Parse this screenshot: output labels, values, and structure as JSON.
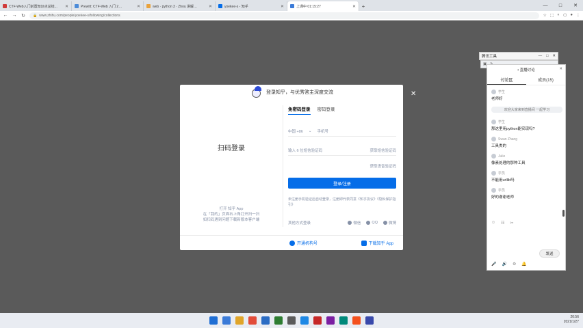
{
  "browser": {
    "tabs": [
      {
        "title": "CTF-Web入门前置知识点总结...",
        "color": "#d03b3b",
        "active": false
      },
      {
        "title": "Prewitt: CTF-Web 入门 2…",
        "color": "#4b8bd8",
        "active": false
      },
      {
        "title": "web · python 3 · Zhou 讲解…",
        "color": "#e9a23b",
        "active": false
      },
      {
        "title": "yoekee-s - 知乎",
        "color": "#056de8",
        "active": false
      },
      {
        "title": "上课中 01:15:27",
        "color": "#3b7bd8",
        "active": true
      }
    ],
    "address": "www.zhihu.com/people/yoekee-s/following/collections",
    "window_controls": [
      "—",
      "□",
      "✕"
    ]
  },
  "modal": {
    "header_text": "登录知乎，与优秀答主深度交流",
    "qr_title": "扫码登录",
    "qr_hint_line1": "打开 知乎 App",
    "qr_hint_line2": "在「我的」页面右上角打开扫一扫",
    "qr_hint_line3": "如扫码遇到问题下载新版本客户端",
    "tab_sms": "免密码登录",
    "tab_password": "密码登录",
    "phone_region": "中国 +86",
    "phone_placeholder": "手机号",
    "code_placeholder": "输入 6 位短信验证码",
    "get_code": "获取短信验证码",
    "voice_code": "获取语音验证码",
    "login_button": "登录/注册",
    "agreement": "未注册手机验证后自动登录，注册即代表同意《知乎协议》《隐私保护指引》",
    "social_label": "其他方式登录",
    "social_items": [
      "微信",
      "QQ",
      "微博"
    ],
    "footer_left": "开通机构号",
    "footer_right": "下载知乎 App",
    "close": "✕"
  },
  "tool": {
    "title": "腾讯工具",
    "controls": [
      "—",
      "□",
      "✕"
    ]
  },
  "chat": {
    "header": "• 直播讨论",
    "close": "✕",
    "tab_discuss": "讨论区",
    "tab_members": "成员(15)",
    "system_note": "欢迎大家来到直播间 一起学习",
    "messages": [
      {
        "user": "学生",
        "text": "老师好"
      },
      {
        "user": "学生",
        "text": "那这里用python能实现吗?"
      },
      {
        "user": "Swan Zhang",
        "text": "工具类的"
      },
      {
        "user": "Julie",
        "text": "像素处理的那种工具"
      },
      {
        "user": "学员",
        "text": "不能用urllib吗"
      },
      {
        "user": "学员",
        "text": "好的谢谢老师"
      }
    ],
    "send": "发送",
    "bottom_icons": [
      "☺",
      "☷",
      "✂"
    ],
    "tool_icons": [
      "🎤",
      "🔊",
      "⚙",
      "🔔"
    ]
  },
  "taskbar": {
    "apps": [
      {
        "glyph": "■",
        "color": "#1f6ed4"
      },
      {
        "glyph": "■",
        "color": "#3b7bd8"
      },
      {
        "glyph": "■",
        "color": "#e0a52a"
      },
      {
        "glyph": "●",
        "color": "#e24c3a"
      },
      {
        "glyph": "■",
        "color": "#2b6cc4"
      },
      {
        "glyph": "◆",
        "color": "#2e7d32"
      },
      {
        "glyph": "■",
        "color": "#5b5b5b"
      },
      {
        "glyph": "●",
        "color": "#1e88e5"
      },
      {
        "glyph": "■",
        "color": "#c62828"
      },
      {
        "glyph": "■",
        "color": "#7b1fa2"
      },
      {
        "glyph": "■",
        "color": "#00897b"
      },
      {
        "glyph": "■",
        "color": "#f4511e"
      },
      {
        "glyph": "■",
        "color": "#3949ab"
      }
    ],
    "time": "20:56",
    "date": "2021/1/27"
  }
}
